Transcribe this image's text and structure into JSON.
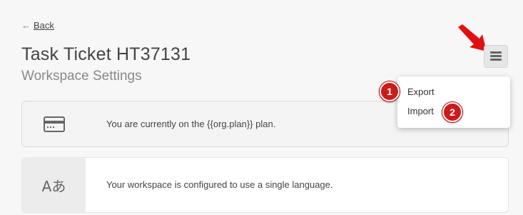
{
  "nav": {
    "back_arrow": "←",
    "back_label": "Back"
  },
  "header": {
    "title": "Task Ticket HT37131",
    "subtitle": "Workspace Settings"
  },
  "menu_button": {
    "icon": "hamburger-icon"
  },
  "dropdown": {
    "items": [
      {
        "label": "Export",
        "badge": "1"
      },
      {
        "label": "Import",
        "badge": "2"
      }
    ]
  },
  "cards": [
    {
      "icon": "credit-card-icon",
      "text": "You are currently on the {{org.plan}} plan."
    },
    {
      "icon": "language-icon",
      "icon_text": "Aあ",
      "text": "Your workspace is configured to use a single language."
    }
  ],
  "colors": {
    "annotation_red": "#cc1b1b",
    "background": "#f7f7f7"
  }
}
